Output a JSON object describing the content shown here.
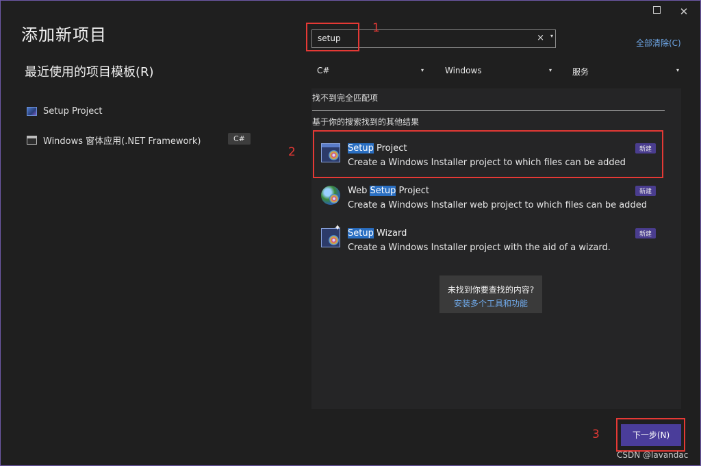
{
  "window": {
    "title": "添加新项目",
    "close_glyph": "✕"
  },
  "recent": {
    "heading": "最近使用的项目模板(R)",
    "items": [
      {
        "label": "Setup Project",
        "icon": "setup-project-icon"
      },
      {
        "label": "Windows 窗体应用(.NET Framework)",
        "icon": "windows-forms-icon",
        "badge": "C#"
      }
    ]
  },
  "search": {
    "value": "setup",
    "clear_glyph": "×",
    "dropdown_glyph": "▾"
  },
  "clear_all": "全部清除(C)",
  "filters": {
    "language": "C#",
    "platform": "Windows",
    "project_type": "服务",
    "arrow": "▾"
  },
  "results": {
    "no_match": "找不到完全匹配项",
    "other_heading": "基于你的搜索找到的其他结果",
    "templates": [
      {
        "pre": "",
        "match": "Setup",
        "post": " Project",
        "description": "Create a Windows Installer project to which files can be added",
        "badge": "新建",
        "icon": "setup-project-icon"
      },
      {
        "pre": "Web ",
        "match": "Setup",
        "post": " Project",
        "description": "Create a Windows Installer web project to which files can be added",
        "badge": "新建",
        "icon": "web-setup-project-icon"
      },
      {
        "pre": "",
        "match": "Setup",
        "post": " Wizard",
        "description": "Create a Windows Installer project with the aid of a wizard.",
        "badge": "新建",
        "icon": "setup-wizard-icon"
      }
    ],
    "help": {
      "question": "未找到你要查找的内容?",
      "link": "安装多个工具和功能"
    }
  },
  "annotations": [
    "1",
    "2",
    "3"
  ],
  "next_button": {
    "label": "下一步(N)"
  },
  "watermark": "CSDN @lavandac",
  "colors": {
    "accent": "#4a3d9a",
    "annotation": "#e53935",
    "link": "#6fa8e8",
    "highlight": "#2a6fc2"
  }
}
